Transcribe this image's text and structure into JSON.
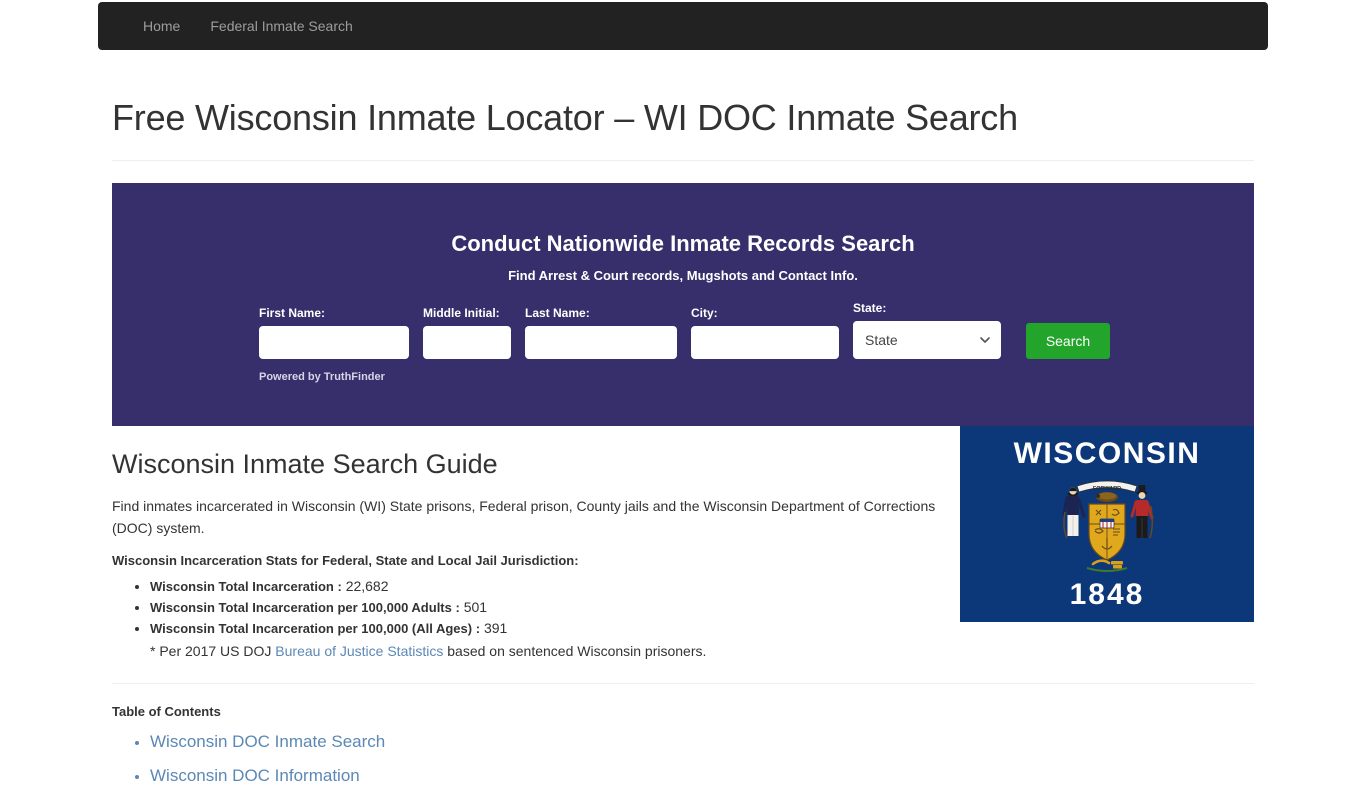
{
  "navbar": {
    "items": [
      {
        "label": "Home"
      },
      {
        "label": "Federal Inmate Search"
      }
    ]
  },
  "header": {
    "page_title": "Free Wisconsin Inmate Locator – WI DOC Inmate Search"
  },
  "search_widget": {
    "title": "Conduct Nationwide Inmate Records Search",
    "subtitle": "Find Arrest & Court records, Mugshots and Contact Info.",
    "accent_color": "#372F6B",
    "button_color": "#23a52b",
    "fields": {
      "first_name": {
        "label": "First Name:",
        "value": "",
        "placeholder": ""
      },
      "middle_initial": {
        "label": "Middle Initial:",
        "value": "",
        "placeholder": ""
      },
      "last_name": {
        "label": "Last Name:",
        "value": "",
        "placeholder": ""
      },
      "city": {
        "label": "City:",
        "value": "",
        "placeholder": ""
      },
      "state": {
        "label": "State:",
        "selected": "State"
      }
    },
    "search_button": "Search",
    "powered_by": "Powered by TruthFinder"
  },
  "guide": {
    "title": "Wisconsin Inmate Search Guide",
    "intro": "Find inmates incarcerated in Wisconsin (WI) State prisons, Federal prison, County jails and the Wisconsin Department of Corrections (DOC) system.",
    "stats_heading": "Wisconsin Incarceration Stats for Federal, State and Local Jail Jurisdiction:",
    "stats": [
      {
        "label": "Wisconsin Total Incarceration  :",
        "value": "22,682"
      },
      {
        "label": "Wisconsin Total Incarceration per 100,000 Adults :",
        "value": "501"
      },
      {
        "label": "Wisconsin Total Incarceration per 100,000 (All Ages) :",
        "value": "391"
      }
    ],
    "note_prefix": "* Per 2017 US DOJ ",
    "note_link": "Bureau of Justice Statistics",
    "note_suffix": " based on sentenced Wisconsin prisoners."
  },
  "flag": {
    "state_name": "WISCONSIN",
    "year": "1848",
    "background_color": "#0c3778",
    "motto": "FORWARD"
  },
  "toc": {
    "title": "Table of Contents",
    "items": [
      {
        "label": "Wisconsin DOC Inmate Search"
      },
      {
        "label": "Wisconsin DOC Information"
      }
    ]
  }
}
